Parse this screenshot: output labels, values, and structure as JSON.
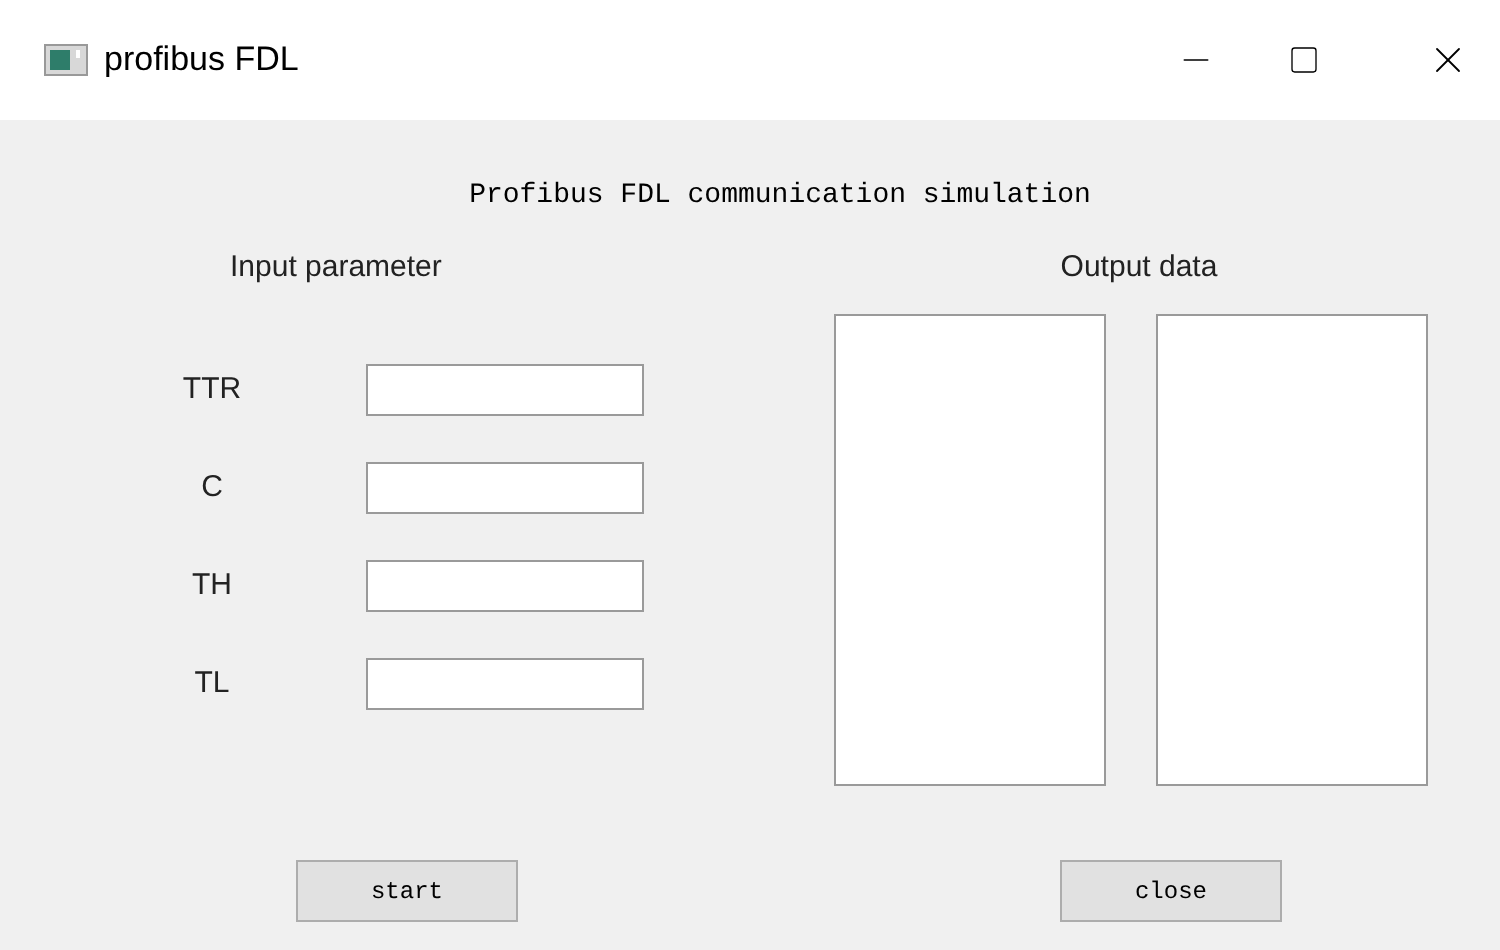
{
  "window": {
    "title": "profibus FDL"
  },
  "heading": "Profibus FDL communication simulation",
  "input": {
    "title": "Input parameter",
    "params": [
      {
        "label": "TTR"
      },
      {
        "label": "C"
      },
      {
        "label": "TH"
      },
      {
        "label": "TL"
      }
    ]
  },
  "output": {
    "title": "Output data"
  },
  "buttons": [
    "start",
    "close"
  ]
}
